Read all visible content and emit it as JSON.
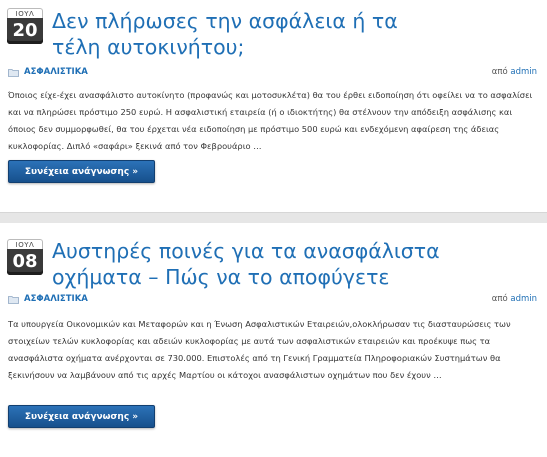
{
  "posts": [
    {
      "date_month": "ΙΟΥΛ",
      "date_day": "20",
      "title": "Δεν πλήρωσες την ασφάλεια ή τα τέλη αυτοκινήτου;",
      "category": "ΑΣΦΑΛΙΣΤΙΚΑ",
      "by_label": "από",
      "author": "admin",
      "excerpt": "Όποιος είχε-έχει ανασφάλιστο αυτοκίνητο (προφανώς και μοτοσυκλέτα) θα του έρθει ειδοποίηση ότι οφείλει να το ασφαλίσει και να πληρώσει πρόστιμο 250 ευρώ. Η ασφαλιστική εταιρεία (ή ο ιδιοκτήτης) θα στέλνουν την απόδειξη ασφάλισης και όποιος δεν συμμορφωθεί, θα του έρχεται νέα ειδοποίηση με πρόστιμο 500 ευρώ και ενδεχόμενη αφαίρεση της άδειας κυκλοφορίας. Διπλό «σαφάρι» ξεκινά από τον Φεβρουάριο …",
      "read_more": "Συνέχεια ανάγνωσης »"
    },
    {
      "date_month": "ΙΟΥΛ",
      "date_day": "08",
      "title": "Αυστηρές ποινές για τα ανασφάλιστα οχήματα – Πώς να το αποφύγετε",
      "category": "ΑΣΦΑΛΙΣΤΙΚΑ",
      "by_label": "από",
      "author": "admin",
      "excerpt": "Τα υπουργεία Οικονομικών και Μεταφορών και η Ένωση Ασφαλιστικών Εταιρειών,ολοκλήρωσαν τις διασταυρώσεις των στοιχείων τελών κυκλοφορίας και αδειών κυκλοφορίας με αυτά των ασφαλιστικών εταιρειών και προέκυψε πως τα ανασφάλιστα οχήματα ανέρχονται σε 730.000. Επιστολές από τη Γενική Γραμματεία Πληροφοριακών Συστημάτων θα ξεκινήσουν να λαμβάνουν από τις αρχές Μαρτίου οι κάτοχοι ανασφάλιστων οχημάτων που δεν έχουν …",
      "read_more": "Συνέχεια ανάγνωσης »"
    }
  ],
  "colors": {
    "link": "#1f6fb5",
    "button": "#17508c",
    "badge": "#3a3a3a"
  },
  "icons": {
    "category": "folder-icon"
  }
}
